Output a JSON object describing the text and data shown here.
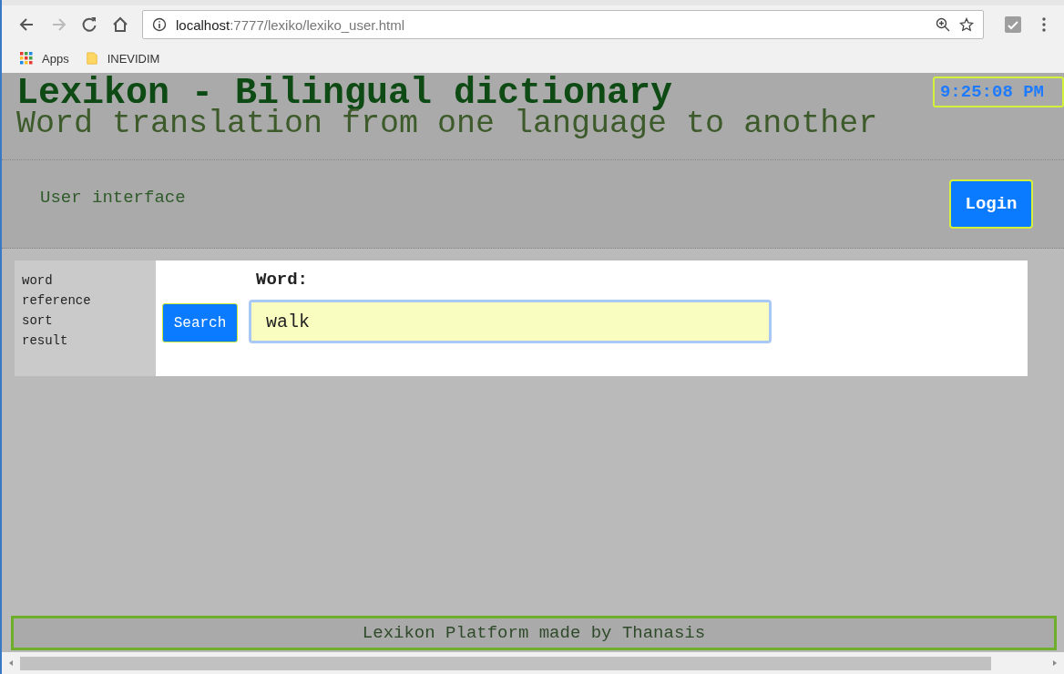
{
  "browser": {
    "url_host": "localhost",
    "url_path": ":7777/lexiko/lexiko_user.html",
    "bookmarks": [
      {
        "label": "Apps",
        "kind": "apps"
      },
      {
        "label": "INEVIDIM",
        "kind": "folder"
      }
    ]
  },
  "header": {
    "title": "Lexikon - Bilingual dictionary",
    "subtitle": "Word translation from one language to another",
    "clock": "9:25:08 PM"
  },
  "nav": {
    "label": "User interface",
    "login_button": "Login"
  },
  "sidebar": {
    "items": [
      "word",
      "reference",
      "sort",
      "result"
    ]
  },
  "search": {
    "label": "Word:",
    "button": "Search",
    "value": "walk"
  },
  "footer": "Lexikon Platform made by Thanasis"
}
